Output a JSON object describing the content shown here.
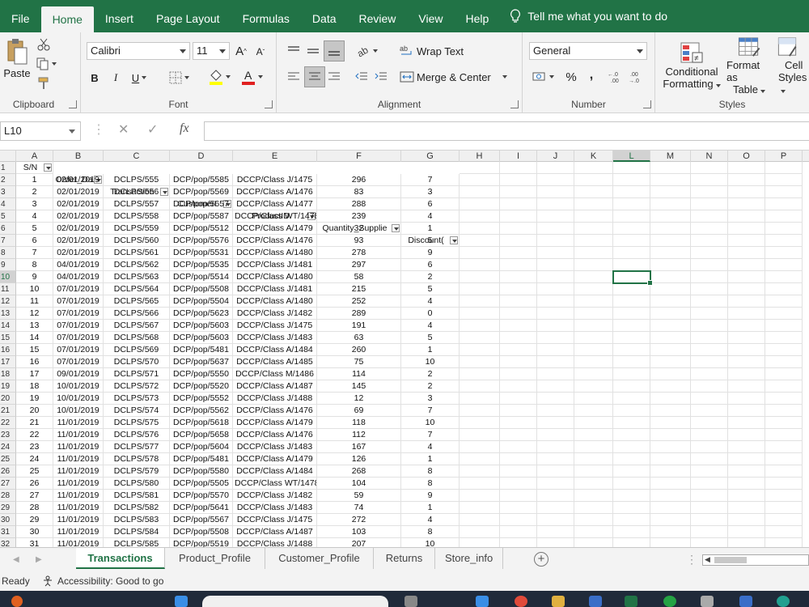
{
  "tabs": [
    {
      "label": "File",
      "active": false
    },
    {
      "label": "Home",
      "active": true
    },
    {
      "label": "Insert",
      "active": false
    },
    {
      "label": "Page Layout",
      "active": false
    },
    {
      "label": "Formulas",
      "active": false
    },
    {
      "label": "Data",
      "active": false
    },
    {
      "label": "Review",
      "active": false
    },
    {
      "label": "View",
      "active": false
    },
    {
      "label": "Help",
      "active": false
    }
  ],
  "tell_me": "Tell me what you want to do",
  "ribbon": {
    "clipboard": {
      "label": "Clipboard",
      "paste": "Paste"
    },
    "font": {
      "label": "Font",
      "name": "Calibri",
      "size": "11",
      "bold": "B",
      "italic": "I",
      "underline": "U"
    },
    "alignment": {
      "label": "Alignment",
      "wrap_text": "Wrap Text",
      "merge_center": "Merge & Center"
    },
    "number": {
      "label": "Number",
      "format": "General",
      "percent": "%",
      "comma": ","
    },
    "styles": {
      "label": "Styles",
      "conditional": "Conditional",
      "conditional2": "Formatting",
      "format_as": "Format as",
      "format_as2": "Table",
      "cell": "Cell",
      "cell2": "Styles"
    }
  },
  "name_box": "L10",
  "formula_content": "",
  "columns": [
    "A",
    "B",
    "C",
    "D",
    "E",
    "F",
    "G",
    "H",
    "I",
    "J",
    "K",
    "L",
    "M",
    "N",
    "O",
    "P"
  ],
  "selected_column": "L",
  "selected_row": 10,
  "headers": [
    "S/N",
    "Order_Da",
    "Transaction",
    "CustomerI",
    "ProductID",
    "Quantity_Supplie",
    "Discount("
  ],
  "rows": [
    [
      "1",
      "02/01/2019",
      "DCLPS/555",
      "DCP/pop/5585",
      "DCCP/Class J/1475",
      "296",
      "7"
    ],
    [
      "2",
      "02/01/2019",
      "DCLPS/556",
      "DCP/pop/5569",
      "DCCP/Class A/1476",
      "83",
      "3"
    ],
    [
      "3",
      "02/01/2019",
      "DCLPS/557",
      "DCP/pop/5657",
      "DCCP/Class A/1477",
      "288",
      "6"
    ],
    [
      "4",
      "02/01/2019",
      "DCLPS/558",
      "DCP/pop/5587",
      "DCCP/Class WT/1478",
      "239",
      "4"
    ],
    [
      "5",
      "02/01/2019",
      "DCLPS/559",
      "DCP/pop/5512",
      "DCCP/Class A/1479",
      "32",
      "1"
    ],
    [
      "6",
      "02/01/2019",
      "DCLPS/560",
      "DCP/pop/5576",
      "DCCP/Class A/1476",
      "93",
      "5"
    ],
    [
      "7",
      "02/01/2019",
      "DCLPS/561",
      "DCP/pop/5531",
      "DCCP/Class A/1480",
      "278",
      "9"
    ],
    [
      "8",
      "04/01/2019",
      "DCLPS/562",
      "DCP/pop/5535",
      "DCCP/Class J/1481",
      "297",
      "6"
    ],
    [
      "9",
      "04/01/2019",
      "DCLPS/563",
      "DCP/pop/5514",
      "DCCP/Class A/1480",
      "58",
      "2"
    ],
    [
      "10",
      "07/01/2019",
      "DCLPS/564",
      "DCP/pop/5508",
      "DCCP/Class J/1481",
      "215",
      "5"
    ],
    [
      "11",
      "07/01/2019",
      "DCLPS/565",
      "DCP/pop/5504",
      "DCCP/Class A/1480",
      "252",
      "4"
    ],
    [
      "12",
      "07/01/2019",
      "DCLPS/566",
      "DCP/pop/5623",
      "DCCP/Class J/1482",
      "289",
      "0"
    ],
    [
      "13",
      "07/01/2019",
      "DCLPS/567",
      "DCP/pop/5603",
      "DCCP/Class J/1475",
      "191",
      "4"
    ],
    [
      "14",
      "07/01/2019",
      "DCLPS/568",
      "DCP/pop/5603",
      "DCCP/Class J/1483",
      "63",
      "5"
    ],
    [
      "15",
      "07/01/2019",
      "DCLPS/569",
      "DCP/pop/5481",
      "DCCP/Class A/1484",
      "260",
      "1"
    ],
    [
      "16",
      "07/01/2019",
      "DCLPS/570",
      "DCP/pop/5637",
      "DCCP/Class A/1485",
      "75",
      "10"
    ],
    [
      "17",
      "09/01/2019",
      "DCLPS/571",
      "DCP/pop/5550",
      "DCCP/Class M/1486",
      "114",
      "2"
    ],
    [
      "18",
      "10/01/2019",
      "DCLPS/572",
      "DCP/pop/5520",
      "DCCP/Class A/1487",
      "145",
      "2"
    ],
    [
      "19",
      "10/01/2019",
      "DCLPS/573",
      "DCP/pop/5552",
      "DCCP/Class J/1488",
      "12",
      "3"
    ],
    [
      "20",
      "10/01/2019",
      "DCLPS/574",
      "DCP/pop/5562",
      "DCCP/Class A/1476",
      "69",
      "7"
    ],
    [
      "21",
      "11/01/2019",
      "DCLPS/575",
      "DCP/pop/5618",
      "DCCP/Class A/1479",
      "118",
      "10"
    ],
    [
      "22",
      "11/01/2019",
      "DCLPS/576",
      "DCP/pop/5658",
      "DCCP/Class A/1476",
      "112",
      "7"
    ],
    [
      "23",
      "11/01/2019",
      "DCLPS/577",
      "DCP/pop/5604",
      "DCCP/Class J/1483",
      "167",
      "4"
    ],
    [
      "24",
      "11/01/2019",
      "DCLPS/578",
      "DCP/pop/5481",
      "DCCP/Class A/1479",
      "126",
      "1"
    ],
    [
      "25",
      "11/01/2019",
      "DCLPS/579",
      "DCP/pop/5580",
      "DCCP/Class A/1484",
      "268",
      "8"
    ],
    [
      "26",
      "11/01/2019",
      "DCLPS/580",
      "DCP/pop/5505",
      "DCCP/Class WT/1478",
      "104",
      "8"
    ],
    [
      "27",
      "11/01/2019",
      "DCLPS/581",
      "DCP/pop/5570",
      "DCCP/Class J/1482",
      "59",
      "9"
    ],
    [
      "28",
      "11/01/2019",
      "DCLPS/582",
      "DCP/pop/5641",
      "DCCP/Class J/1483",
      "74",
      "1"
    ],
    [
      "29",
      "11/01/2019",
      "DCLPS/583",
      "DCP/pop/5567",
      "DCCP/Class J/1475",
      "272",
      "4"
    ],
    [
      "30",
      "11/01/2019",
      "DCLPS/584",
      "DCP/pop/5508",
      "DCCP/Class A/1487",
      "103",
      "8"
    ],
    [
      "31",
      "11/01/2019",
      "DCLPS/585",
      "DCP/pop/5519",
      "DCCP/Class J/1488",
      "207",
      "10"
    ]
  ],
  "sheets": [
    {
      "label": "Transactions",
      "active": true
    },
    {
      "label": "Product_Profile",
      "active": false
    },
    {
      "label": "Customer_Profile",
      "active": false
    },
    {
      "label": "Returns",
      "active": false
    },
    {
      "label": "Store_info",
      "active": false
    }
  ],
  "status": {
    "ready": "Ready",
    "accessibility": "Accessibility: Good to go"
  },
  "colors": {
    "excel_green": "#217346",
    "ribbon_bg": "#f3f3f3",
    "taskbar": "#202a3a"
  }
}
